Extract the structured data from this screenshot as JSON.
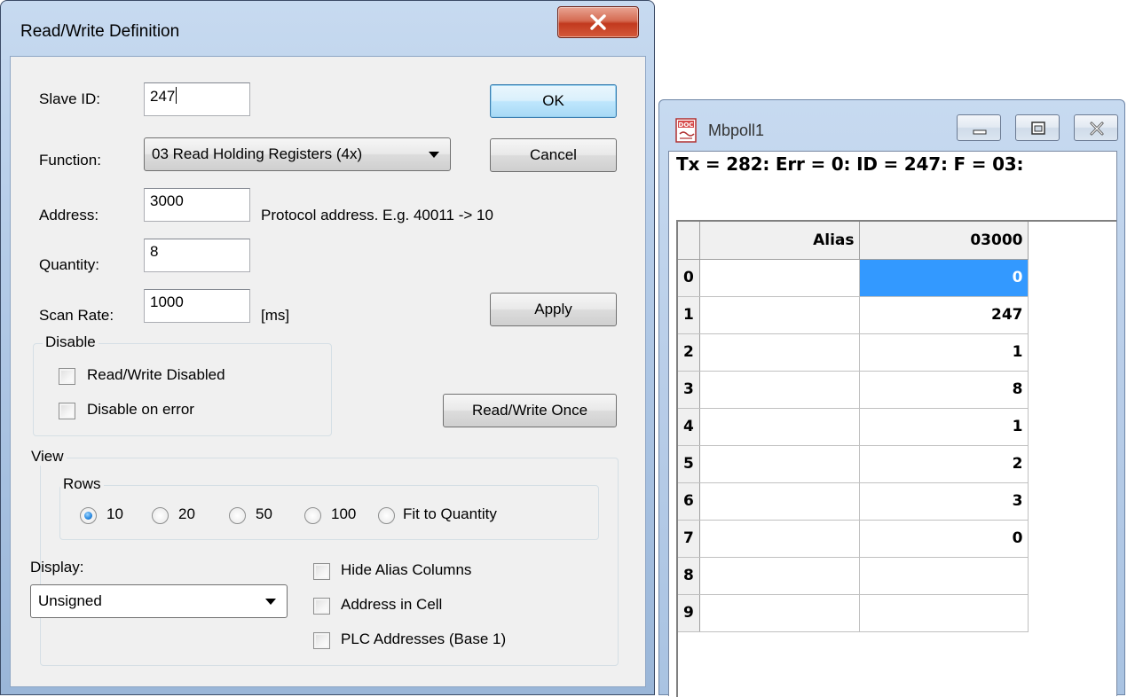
{
  "dialog": {
    "title": "Read/Write Definition",
    "slave_id": {
      "label": "Slave ID:",
      "value": "247"
    },
    "function": {
      "label": "Function:",
      "value": "03 Read Holding Registers (4x)"
    },
    "address": {
      "label": "Address:",
      "value": "3000",
      "hint": "Protocol address. E.g. 40011 -> 10"
    },
    "quantity": {
      "label": "Quantity:",
      "value": "8"
    },
    "scan_rate": {
      "label": "Scan Rate:",
      "value": "1000",
      "unit": "[ms]"
    },
    "buttons": {
      "ok": "OK",
      "cancel": "Cancel",
      "apply": "Apply",
      "read_write_once": "Read/Write Once"
    },
    "disable_group": {
      "title": "Disable",
      "read_write_disabled": "Read/Write Disabled",
      "disable_on_error": "Disable on error"
    },
    "view_group": {
      "title": "View",
      "rows_title": "Rows",
      "rows_options": [
        "10",
        "20",
        "50",
        "100",
        "Fit to Quantity"
      ],
      "rows_selected": "10",
      "display_label": "Display:",
      "display_value": "Unsigned",
      "hide_alias_columns": "Hide Alias Columns",
      "address_in_cell": "Address in Cell",
      "plc_addresses": "PLC Addresses (Base 1)"
    }
  },
  "mbpoll": {
    "title": "Mbpoll1",
    "status": "Tx = 282: Err = 0: ID = 247: F = 03:",
    "grid": {
      "columns": [
        "Alias",
        "03000"
      ],
      "rows": [
        {
          "index": "0",
          "alias": "",
          "value": "0"
        },
        {
          "index": "1",
          "alias": "",
          "value": "247"
        },
        {
          "index": "2",
          "alias": "",
          "value": "1"
        },
        {
          "index": "3",
          "alias": "",
          "value": "8"
        },
        {
          "index": "4",
          "alias": "",
          "value": "1"
        },
        {
          "index": "5",
          "alias": "",
          "value": "2"
        },
        {
          "index": "6",
          "alias": "",
          "value": "3"
        },
        {
          "index": "7",
          "alias": "",
          "value": "0"
        },
        {
          "index": "8",
          "alias": "",
          "value": ""
        },
        {
          "index": "9",
          "alias": "",
          "value": ""
        }
      ]
    }
  },
  "colors": {
    "selection": "#3399ff",
    "close_button": "#c2391e",
    "default_button": "#bee6fd"
  }
}
